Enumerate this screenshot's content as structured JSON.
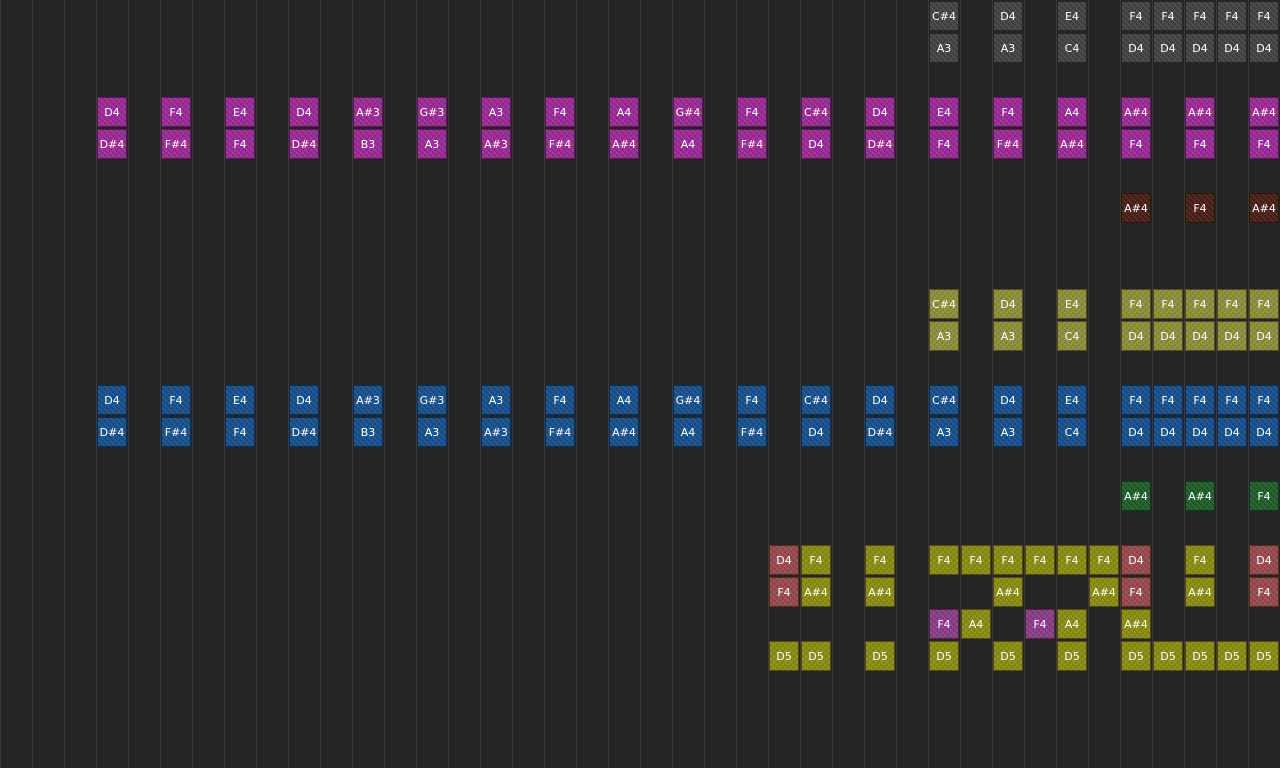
{
  "colors": {
    "background": "#252527",
    "gridline": "#3a3a3c",
    "gray": "#434346",
    "magenta": "#9c2a96",
    "brown": "#4a1f17",
    "olive": "#8c9038",
    "blue": "#18508e",
    "green": "#1f5e28",
    "rose": "#9a4a4e",
    "yellow": "#8c8c12",
    "purple": "#8a3e88"
  },
  "tracks": [
    {
      "color": "gray",
      "notes": [
        {
          "col": 29,
          "row": 0,
          "label": "C#4"
        },
        {
          "col": 31,
          "row": 0,
          "label": "D4"
        },
        {
          "col": 33,
          "row": 0,
          "label": "E4"
        },
        {
          "col": 35,
          "row": 0,
          "label": "F4"
        },
        {
          "col": 36,
          "row": 0,
          "label": "F4"
        },
        {
          "col": 37,
          "row": 0,
          "label": "F4"
        },
        {
          "col": 38,
          "row": 0,
          "label": "F4"
        },
        {
          "col": 39,
          "row": 0,
          "label": "F4"
        },
        {
          "col": 29,
          "row": 1,
          "label": "A3"
        },
        {
          "col": 31,
          "row": 1,
          "label": "A3"
        },
        {
          "col": 33,
          "row": 1,
          "label": "C4"
        },
        {
          "col": 35,
          "row": 1,
          "label": "D4"
        },
        {
          "col": 36,
          "row": 1,
          "label": "D4"
        },
        {
          "col": 37,
          "row": 1,
          "label": "D4"
        },
        {
          "col": 38,
          "row": 1,
          "label": "D4"
        },
        {
          "col": 39,
          "row": 1,
          "label": "D4"
        }
      ]
    },
    {
      "color": "magenta",
      "notes": [
        {
          "col": 3,
          "row": 3,
          "label": "D4"
        },
        {
          "col": 5,
          "row": 3,
          "label": "F4"
        },
        {
          "col": 7,
          "row": 3,
          "label": "E4"
        },
        {
          "col": 9,
          "row": 3,
          "label": "D4"
        },
        {
          "col": 11,
          "row": 3,
          "label": "A#3"
        },
        {
          "col": 13,
          "row": 3,
          "label": "G#3"
        },
        {
          "col": 15,
          "row": 3,
          "label": "A3"
        },
        {
          "col": 17,
          "row": 3,
          "label": "F4"
        },
        {
          "col": 19,
          "row": 3,
          "label": "A4"
        },
        {
          "col": 21,
          "row": 3,
          "label": "G#4"
        },
        {
          "col": 23,
          "row": 3,
          "label": "F4"
        },
        {
          "col": 25,
          "row": 3,
          "label": "C#4"
        },
        {
          "col": 27,
          "row": 3,
          "label": "D4"
        },
        {
          "col": 29,
          "row": 3,
          "label": "E4"
        },
        {
          "col": 31,
          "row": 3,
          "label": "F4"
        },
        {
          "col": 33,
          "row": 3,
          "label": "A4"
        },
        {
          "col": 35,
          "row": 3,
          "label": "A#4"
        },
        {
          "col": 37,
          "row": 3,
          "label": "A#4"
        },
        {
          "col": 39,
          "row": 3,
          "label": "A#4"
        },
        {
          "col": 3,
          "row": 4,
          "label": "D#4"
        },
        {
          "col": 5,
          "row": 4,
          "label": "F#4"
        },
        {
          "col": 7,
          "row": 4,
          "label": "F4"
        },
        {
          "col": 9,
          "row": 4,
          "label": "D#4"
        },
        {
          "col": 11,
          "row": 4,
          "label": "B3"
        },
        {
          "col": 13,
          "row": 4,
          "label": "A3"
        },
        {
          "col": 15,
          "row": 4,
          "label": "A#3"
        },
        {
          "col": 17,
          "row": 4,
          "label": "F#4"
        },
        {
          "col": 19,
          "row": 4,
          "label": "A#4"
        },
        {
          "col": 21,
          "row": 4,
          "label": "A4"
        },
        {
          "col": 23,
          "row": 4,
          "label": "F#4"
        },
        {
          "col": 25,
          "row": 4,
          "label": "D4"
        },
        {
          "col": 27,
          "row": 4,
          "label": "D#4"
        },
        {
          "col": 29,
          "row": 4,
          "label": "F4"
        },
        {
          "col": 31,
          "row": 4,
          "label": "F#4"
        },
        {
          "col": 33,
          "row": 4,
          "label": "A#4"
        },
        {
          "col": 35,
          "row": 4,
          "label": "F4"
        },
        {
          "col": 37,
          "row": 4,
          "label": "F4"
        },
        {
          "col": 39,
          "row": 4,
          "label": "F4"
        }
      ]
    },
    {
      "color": "brown",
      "notes": [
        {
          "col": 35,
          "row": 6,
          "label": "A#4"
        },
        {
          "col": 37,
          "row": 6,
          "label": "F4"
        },
        {
          "col": 39,
          "row": 6,
          "label": "A#4"
        }
      ]
    },
    {
      "color": "olive",
      "notes": [
        {
          "col": 29,
          "row": 9,
          "label": "C#4"
        },
        {
          "col": 31,
          "row": 9,
          "label": "D4"
        },
        {
          "col": 33,
          "row": 9,
          "label": "E4"
        },
        {
          "col": 35,
          "row": 9,
          "label": "F4"
        },
        {
          "col": 36,
          "row": 9,
          "label": "F4"
        },
        {
          "col": 37,
          "row": 9,
          "label": "F4"
        },
        {
          "col": 38,
          "row": 9,
          "label": "F4"
        },
        {
          "col": 39,
          "row": 9,
          "label": "F4"
        },
        {
          "col": 29,
          "row": 10,
          "label": "A3"
        },
        {
          "col": 31,
          "row": 10,
          "label": "A3"
        },
        {
          "col": 33,
          "row": 10,
          "label": "C4"
        },
        {
          "col": 35,
          "row": 10,
          "label": "D4"
        },
        {
          "col": 36,
          "row": 10,
          "label": "D4"
        },
        {
          "col": 37,
          "row": 10,
          "label": "D4"
        },
        {
          "col": 38,
          "row": 10,
          "label": "D4"
        },
        {
          "col": 39,
          "row": 10,
          "label": "D4"
        }
      ]
    },
    {
      "color": "blue",
      "notes": [
        {
          "col": 3,
          "row": 12,
          "label": "D4"
        },
        {
          "col": 5,
          "row": 12,
          "label": "F4"
        },
        {
          "col": 7,
          "row": 12,
          "label": "E4"
        },
        {
          "col": 9,
          "row": 12,
          "label": "D4"
        },
        {
          "col": 11,
          "row": 12,
          "label": "A#3"
        },
        {
          "col": 13,
          "row": 12,
          "label": "G#3"
        },
        {
          "col": 15,
          "row": 12,
          "label": "A3"
        },
        {
          "col": 17,
          "row": 12,
          "label": "F4"
        },
        {
          "col": 19,
          "row": 12,
          "label": "A4"
        },
        {
          "col": 21,
          "row": 12,
          "label": "G#4"
        },
        {
          "col": 23,
          "row": 12,
          "label": "F4"
        },
        {
          "col": 25,
          "row": 12,
          "label": "C#4"
        },
        {
          "col": 27,
          "row": 12,
          "label": "D4"
        },
        {
          "col": 29,
          "row": 12,
          "label": "C#4"
        },
        {
          "col": 31,
          "row": 12,
          "label": "D4"
        },
        {
          "col": 33,
          "row": 12,
          "label": "E4"
        },
        {
          "col": 35,
          "row": 12,
          "label": "F4"
        },
        {
          "col": 36,
          "row": 12,
          "label": "F4"
        },
        {
          "col": 37,
          "row": 12,
          "label": "F4"
        },
        {
          "col": 38,
          "row": 12,
          "label": "F4"
        },
        {
          "col": 39,
          "row": 12,
          "label": "F4"
        },
        {
          "col": 3,
          "row": 13,
          "label": "D#4"
        },
        {
          "col": 5,
          "row": 13,
          "label": "F#4"
        },
        {
          "col": 7,
          "row": 13,
          "label": "F4"
        },
        {
          "col": 9,
          "row": 13,
          "label": "D#4"
        },
        {
          "col": 11,
          "row": 13,
          "label": "B3"
        },
        {
          "col": 13,
          "row": 13,
          "label": "A3"
        },
        {
          "col": 15,
          "row": 13,
          "label": "A#3"
        },
        {
          "col": 17,
          "row": 13,
          "label": "F#4"
        },
        {
          "col": 19,
          "row": 13,
          "label": "A#4"
        },
        {
          "col": 21,
          "row": 13,
          "label": "A4"
        },
        {
          "col": 23,
          "row": 13,
          "label": "F#4"
        },
        {
          "col": 25,
          "row": 13,
          "label": "D4"
        },
        {
          "col": 27,
          "row": 13,
          "label": "D#4"
        },
        {
          "col": 29,
          "row": 13,
          "label": "A3"
        },
        {
          "col": 31,
          "row": 13,
          "label": "A3"
        },
        {
          "col": 33,
          "row": 13,
          "label": "C4"
        },
        {
          "col": 35,
          "row": 13,
          "label": "D4"
        },
        {
          "col": 36,
          "row": 13,
          "label": "D4"
        },
        {
          "col": 37,
          "row": 13,
          "label": "D4"
        },
        {
          "col": 38,
          "row": 13,
          "label": "D4"
        },
        {
          "col": 39,
          "row": 13,
          "label": "D4"
        }
      ]
    },
    {
      "color": "green",
      "notes": [
        {
          "col": 35,
          "row": 15,
          "label": "A#4"
        },
        {
          "col": 37,
          "row": 15,
          "label": "A#4"
        },
        {
          "col": 39,
          "row": 15,
          "label": "F4"
        }
      ]
    },
    {
      "color": "rose",
      "notes": [
        {
          "col": 24,
          "row": 17,
          "label": "D4"
        },
        {
          "col": 35,
          "row": 17,
          "label": "D4"
        },
        {
          "col": 39,
          "row": 17,
          "label": "D4"
        },
        {
          "col": 24,
          "row": 18,
          "label": "F4"
        },
        {
          "col": 35,
          "row": 18,
          "label": "F4"
        },
        {
          "col": 39,
          "row": 18,
          "label": "F4"
        }
      ]
    },
    {
      "color": "yellow",
      "notes": [
        {
          "col": 25,
          "row": 17,
          "label": "F4"
        },
        {
          "col": 27,
          "row": 17,
          "label": "F4"
        },
        {
          "col": 29,
          "row": 17,
          "label": "F4"
        },
        {
          "col": 30,
          "row": 17,
          "label": "F4"
        },
        {
          "col": 31,
          "row": 17,
          "label": "F4"
        },
        {
          "col": 32,
          "row": 17,
          "label": "F4"
        },
        {
          "col": 33,
          "row": 17,
          "label": "F4"
        },
        {
          "col": 34,
          "row": 17,
          "label": "F4"
        },
        {
          "col": 37,
          "row": 17,
          "label": "F4"
        },
        {
          "col": 25,
          "row": 18,
          "label": "A#4"
        },
        {
          "col": 27,
          "row": 18,
          "label": "A#4"
        },
        {
          "col": 31,
          "row": 18,
          "label": "A#4"
        },
        {
          "col": 34,
          "row": 18,
          "label": "A#4"
        },
        {
          "col": 37,
          "row": 18,
          "label": "A#4"
        },
        {
          "col": 30,
          "row": 19,
          "label": "A4"
        },
        {
          "col": 33,
          "row": 19,
          "label": "A4"
        },
        {
          "col": 35,
          "row": 19,
          "label": "A#4"
        },
        {
          "col": 24,
          "row": 20,
          "label": "D5"
        },
        {
          "col": 25,
          "row": 20,
          "label": "D5"
        },
        {
          "col": 27,
          "row": 20,
          "label": "D5"
        },
        {
          "col": 29,
          "row": 20,
          "label": "D5"
        },
        {
          "col": 31,
          "row": 20,
          "label": "D5"
        },
        {
          "col": 33,
          "row": 20,
          "label": "D5"
        },
        {
          "col": 35,
          "row": 20,
          "label": "D5"
        },
        {
          "col": 36,
          "row": 20,
          "label": "D5"
        },
        {
          "col": 37,
          "row": 20,
          "label": "D5"
        },
        {
          "col": 38,
          "row": 20,
          "label": "D5"
        },
        {
          "col": 39,
          "row": 20,
          "label": "D5"
        }
      ]
    },
    {
      "color": "purple",
      "notes": [
        {
          "col": 29,
          "row": 19,
          "label": "F4"
        },
        {
          "col": 32,
          "row": 19,
          "label": "F4"
        }
      ]
    }
  ]
}
